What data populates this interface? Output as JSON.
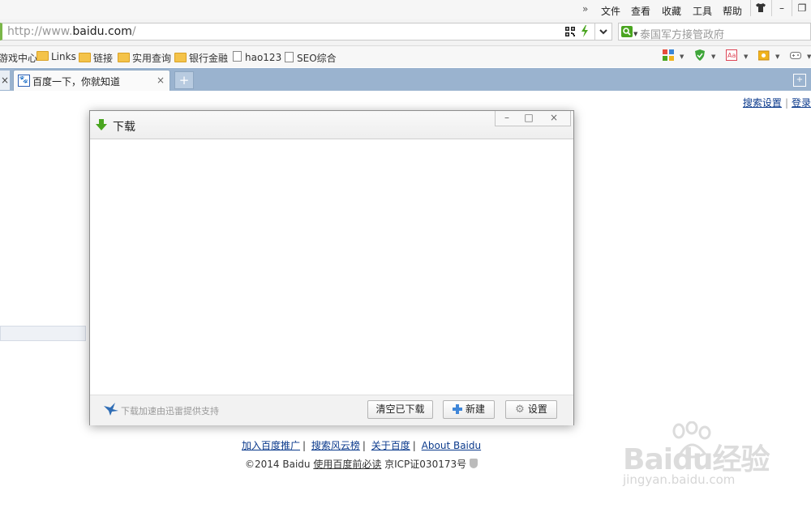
{
  "menu": {
    "more": "»",
    "items": [
      "文件",
      "查看",
      "收藏",
      "工具",
      "帮助"
    ],
    "window_controls": [
      "⌂",
      "–",
      "❐"
    ]
  },
  "address_bar": {
    "url_prefix": "http://www.",
    "url_domain": "baidu.com",
    "url_suffix": "/",
    "dropdown": "⌄"
  },
  "search_box": {
    "text": "泰国军方接管政府"
  },
  "bookmarks": [
    {
      "label": "游戏中心",
      "icon": "none"
    },
    {
      "label": "Links",
      "icon": "folder"
    },
    {
      "label": "链接",
      "icon": "folder"
    },
    {
      "label": "实用查询",
      "icon": "folder"
    },
    {
      "label": "银行金融",
      "icon": "folder"
    },
    {
      "label": "hao123",
      "icon": "page"
    },
    {
      "label": "SEO综合",
      "icon": "page"
    }
  ],
  "tabs": {
    "left_close": "×",
    "active_title": "百度一下，你就知道",
    "close": "×",
    "new_tab": "+"
  },
  "page": {
    "top_links": [
      "搜索设置",
      "登录"
    ],
    "footer_links": [
      "加入百度推广",
      "搜索风云榜",
      "关于百度",
      "About Baidu"
    ],
    "copyright_prefix": "©2014 Baidu ",
    "copyright_link": "使用百度前必读",
    "icp": " 京ICP证030173号"
  },
  "download_dialog": {
    "title": "下载",
    "controls": [
      "–",
      "□",
      "×"
    ],
    "support_text": "下载加速由迅雷提供支持",
    "buttons": {
      "clear": "清空已下载",
      "new": "新建",
      "settings": "设置"
    }
  },
  "watermark": {
    "brand": "Baidu经验",
    "url": "jingyan.baidu.com"
  },
  "colors": {
    "tab_strip": "#9ab3cf",
    "link": "#0b3a8c",
    "accent_green": "#4aa520"
  }
}
